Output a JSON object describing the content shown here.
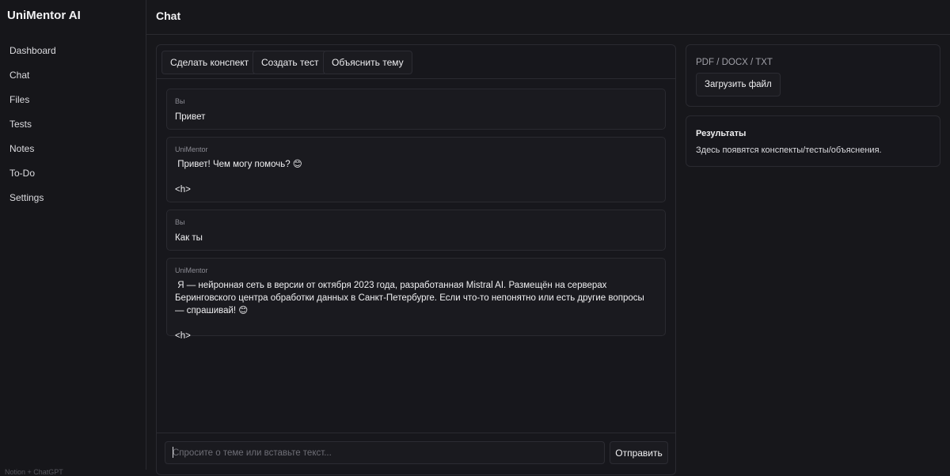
{
  "app": {
    "title": "UniMentor AI",
    "footer": "Notion + ChatGPT"
  },
  "sidebar": {
    "items": [
      {
        "label": "Dashboard"
      },
      {
        "label": "Chat"
      },
      {
        "label": "Files"
      },
      {
        "label": "Tests"
      },
      {
        "label": "Notes"
      },
      {
        "label": "To-Do"
      },
      {
        "label": "Settings"
      }
    ]
  },
  "header": {
    "title": "Chat"
  },
  "toolbar": {
    "buttons": [
      {
        "label": "Сделать конспект"
      },
      {
        "label": "Создать тест"
      },
      {
        "label": "Объяснить тему"
      }
    ]
  },
  "messages": [
    {
      "author": "Вы",
      "text": "Привет"
    },
    {
      "author": "UniMentor",
      "text": " Привет! Чем могу помочь? 😊\n\n<h>"
    },
    {
      "author": "Вы",
      "text": "Как ты"
    },
    {
      "author": "UniMentor",
      "text": " Я — нейронная сеть в версии от октября 2023 года, разработанная Mistral AI. Размещён на серверах Беринговского центра обработки данных в Санкт-Петербурге. Если что-то непонятно или есть другие вопросы — спрашивай! 😊\n\n<h>"
    }
  ],
  "composer": {
    "value": "",
    "placeholder": "Спросите о теме или вставьте текст...",
    "send_label": "Отправить"
  },
  "upload": {
    "formats": "PDF / DOCX / TXT",
    "button_label": "Загрузить файл"
  },
  "results": {
    "title": "Результаты",
    "text": "Здесь появятся конспекты/тесты/объяснения."
  }
}
